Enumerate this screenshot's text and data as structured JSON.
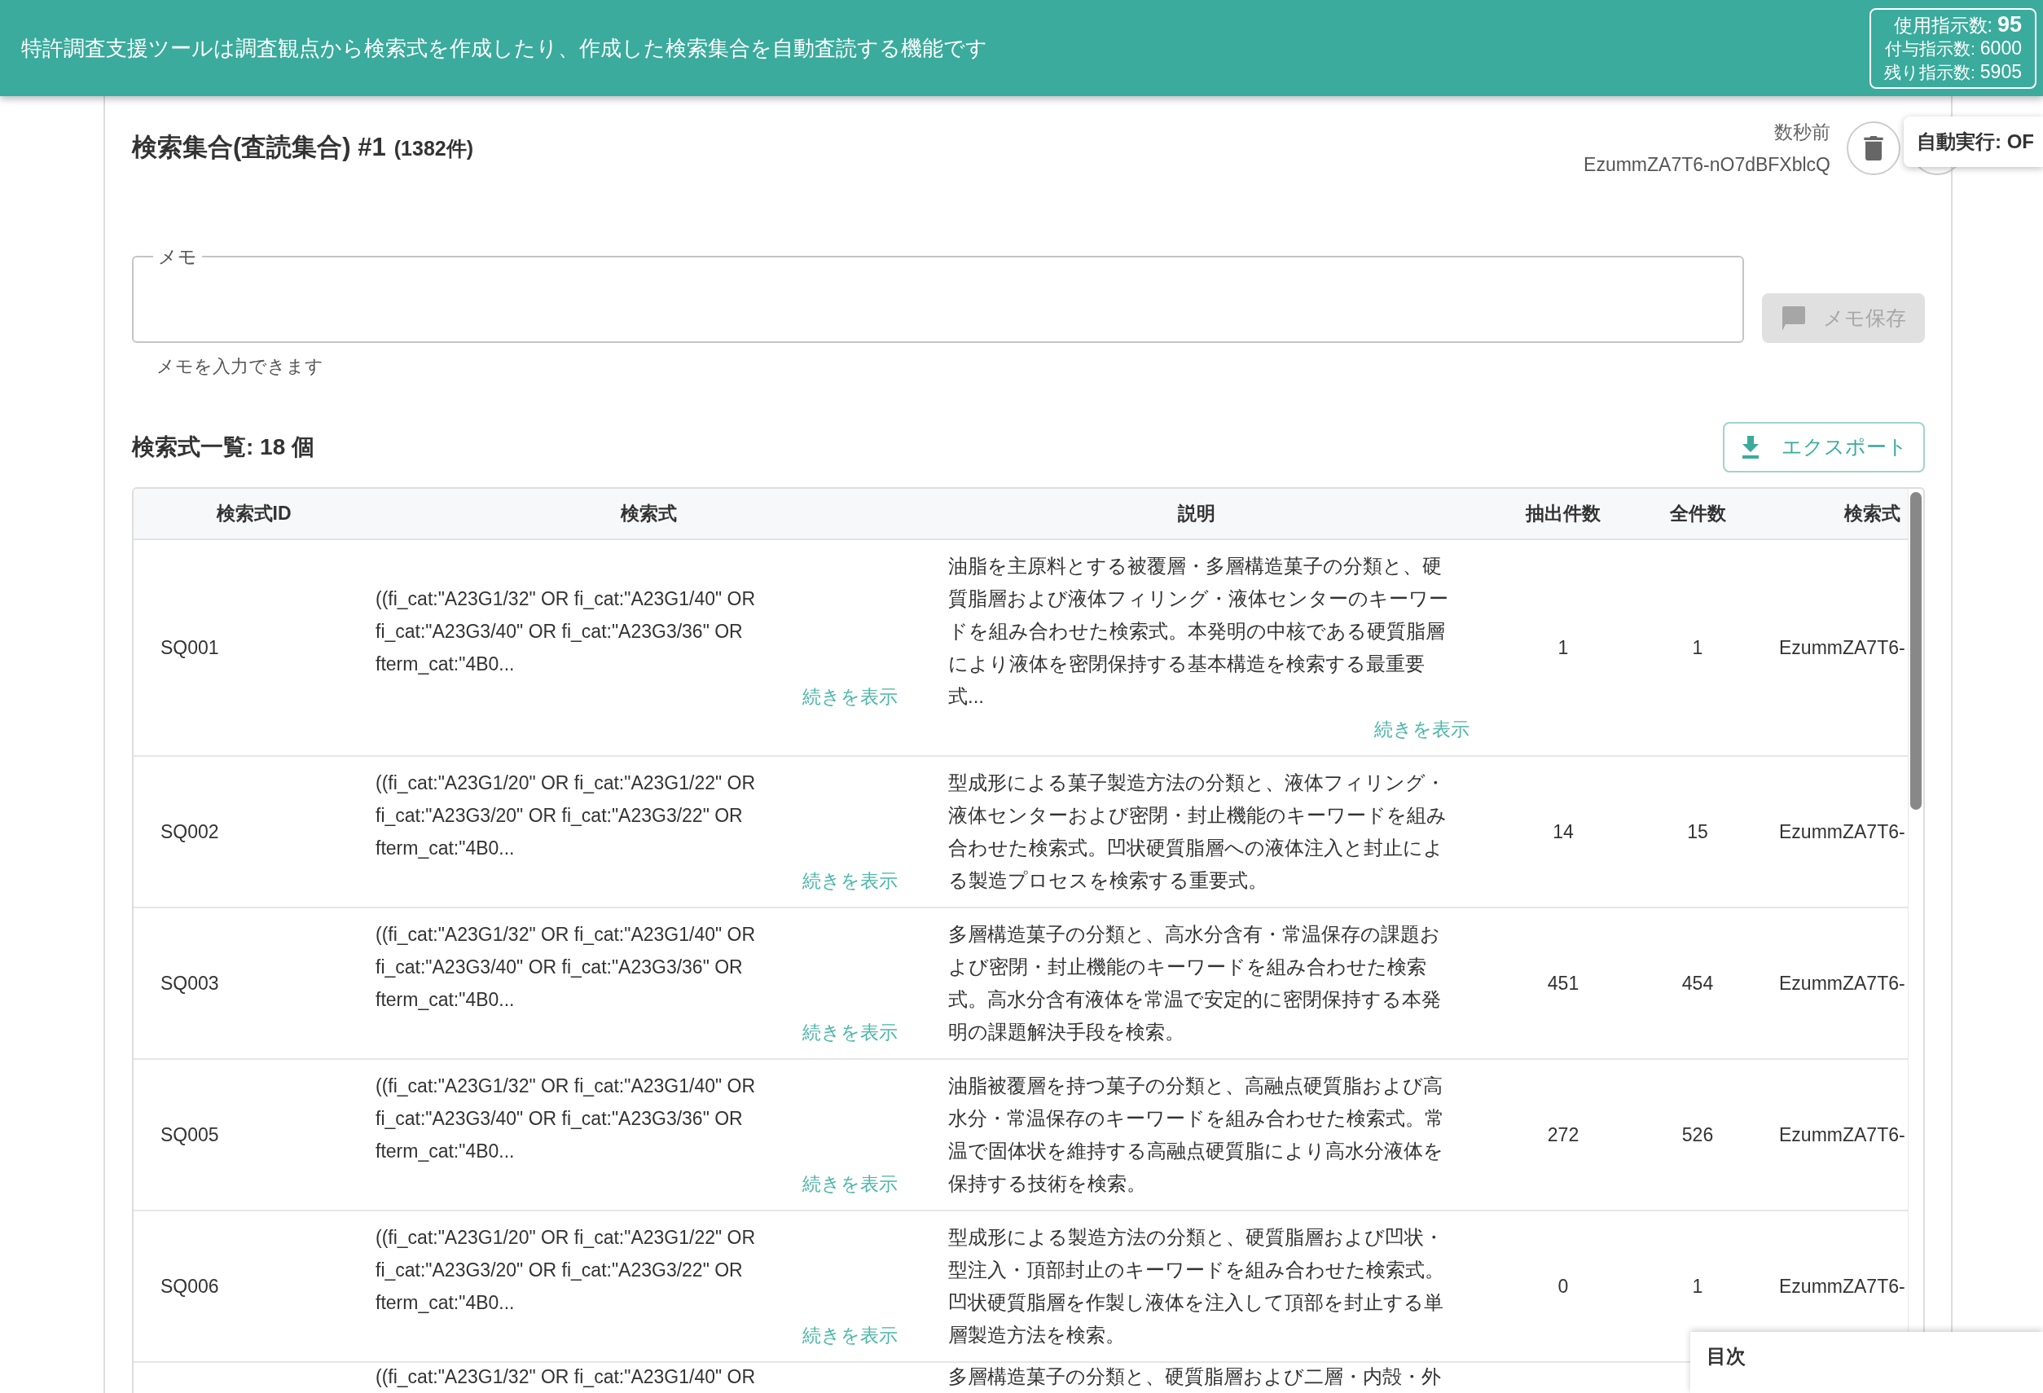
{
  "header": {
    "message": "特許調査支援ツールは調査観点から検索式を作成したり、作成した検索集合を自動査読する機能です",
    "usage": [
      {
        "label": "使用指示数:",
        "value": "95",
        "kind": "primary"
      },
      {
        "label": "付与指示数:",
        "value": "6000",
        "kind": "secondary"
      },
      {
        "label": "残り指示数:",
        "value": "5905",
        "kind": "secondary"
      }
    ]
  },
  "set": {
    "title": "検索集合(査読集合) #1",
    "count": "(1382件)",
    "updated": "数秒前",
    "id": "EzummZA7T6-nO7dBFXblcQ"
  },
  "auto_run": {
    "label": "自動実行: OF"
  },
  "memo": {
    "label": "メモ",
    "helper": "メモを入力できます",
    "save_button": "メモ保存",
    "disabled": true
  },
  "query_list": {
    "title": "検索式一覧: 18 個",
    "export_button": "エクスポート"
  },
  "table": {
    "columns": [
      "検索式ID",
      "検索式",
      "説明",
      "抽出件数",
      "全件数",
      "検索式"
    ],
    "rows": [
      {
        "id": "SQ001",
        "query": "((fi_cat:\"A23G1/32\" OR fi_cat:\"A23G1/40\" OR fi_cat:\"A23G3/40\" OR fi_cat:\"A23G3/36\" OR fterm_cat:\"4B0...",
        "query_more": "続きを表示",
        "description": "油脂を主原料とする被覆層・多層構造菓子の分類と、硬質脂層および液体フィリング・液体センターのキーワードを組み合わせた検索式。本発明の中核である硬質脂層により液体を密閉保持する基本構造を検索する最重要式...",
        "description_more": "続きを表示",
        "extracted": "1",
        "total": "1",
        "set_id": "EzummZA7T6-"
      },
      {
        "id": "SQ002",
        "query": "((fi_cat:\"A23G1/20\" OR fi_cat:\"A23G1/22\" OR fi_cat:\"A23G3/20\" OR fi_cat:\"A23G3/22\" OR fterm_cat:\"4B0...",
        "query_more": "続きを表示",
        "description": "型成形による菓子製造方法の分類と、液体フィリング・液体センターおよび密閉・封止機能のキーワードを組み合わせた検索式。凹状硬質脂層への液体注入と封止による製造プロセスを検索する重要式。",
        "extracted": "14",
        "total": "15",
        "set_id": "EzummZA7T6-"
      },
      {
        "id": "SQ003",
        "query": "((fi_cat:\"A23G1/32\" OR fi_cat:\"A23G1/40\" OR fi_cat:\"A23G3/40\" OR fi_cat:\"A23G3/36\" OR fterm_cat:\"4B0...",
        "query_more": "続きを表示",
        "description": "多層構造菓子の分類と、高水分含有・常温保存の課題および密閉・封止機能のキーワードを組み合わせた検索式。高水分含有液体を常温で安定的に密閉保持する本発明の課題解決手段を検索。",
        "extracted": "451",
        "total": "454",
        "set_id": "EzummZA7T6-"
      },
      {
        "id": "SQ005",
        "query": "((fi_cat:\"A23G1/32\" OR fi_cat:\"A23G1/40\" OR fi_cat:\"A23G3/40\" OR fi_cat:\"A23G3/36\" OR fterm_cat:\"4B0...",
        "query_more": "続きを表示",
        "description": "油脂被覆層を持つ菓子の分類と、高融点硬質脂および高水分・常温保存のキーワードを組み合わせた検索式。常温で固体状を維持する高融点硬質脂により高水分液体を保持する技術を検索。",
        "extracted": "272",
        "total": "526",
        "set_id": "EzummZA7T6-"
      },
      {
        "id": "SQ006",
        "query": "((fi_cat:\"A23G1/20\" OR fi_cat:\"A23G1/22\" OR fi_cat:\"A23G3/20\" OR fi_cat:\"A23G3/22\" OR fterm_cat:\"4B0...",
        "query_more": "続きを表示",
        "description": "型成形による製造方法の分類と、硬質脂層および凹状・型注入・頂部封止のキーワードを組み合わせた検索式。凹状硬質脂層を作製し液体を注入して頂部を封止する単層製造方法を検索。",
        "extracted": "0",
        "total": "1",
        "set_id": "EzummZA7T6-"
      },
      {
        "query": "((fi_cat:\"A23G1/32\" OR fi_cat:\"A23G1/40\" OR",
        "description": "多層構造菓子の分類と、硬質脂層および二層・内殻・外"
      }
    ]
  },
  "toc": {
    "label": "目次"
  }
}
